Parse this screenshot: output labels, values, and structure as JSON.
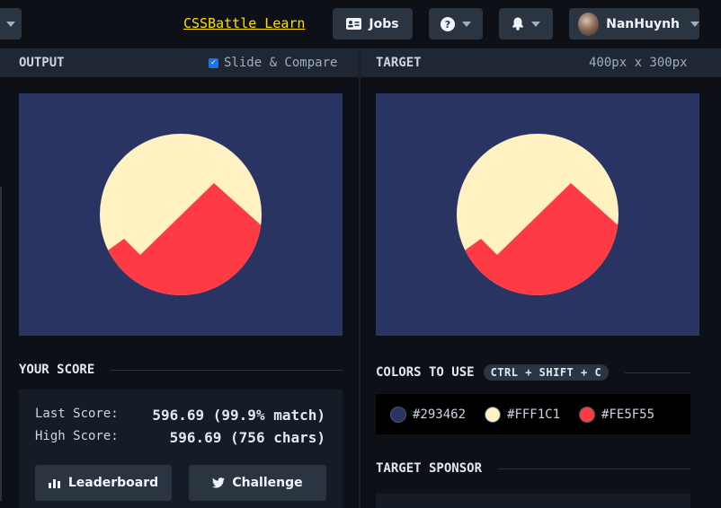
{
  "topbar": {
    "learn_link": "CSSBattle Learn",
    "jobs_label": "Jobs",
    "help_icon": "question-circle-icon",
    "bell_icon": "bell-icon",
    "username": "NanHuynh"
  },
  "output_panel": {
    "title": "OUTPUT",
    "slide_compare_label": "Slide & Compare",
    "slide_compare_checked": true
  },
  "target_panel": {
    "title": "TARGET",
    "dimensions": "400px x 300px"
  },
  "score": {
    "section_title": "YOUR SCORE",
    "last_label": "Last Score:",
    "last_value": "596.69 (99.9% match)",
    "high_label": "High Score:",
    "high_value": "596.69 (756 chars)",
    "leaderboard_label": "Leaderboard",
    "challenge_label": "Challenge"
  },
  "colors": {
    "section_title": "COLORS TO USE",
    "shortcut": "CTRL + SHIFT + C",
    "items": [
      {
        "hex": "#293462"
      },
      {
        "hex": "#FFF1C1"
      },
      {
        "hex": "#FE5F55"
      }
    ]
  },
  "sponsor": {
    "section_title": "TARGET SPONSOR"
  },
  "palette": {
    "bg": "#293462",
    "sun": "#FFF1C1",
    "mountain": "#FE3B45"
  }
}
